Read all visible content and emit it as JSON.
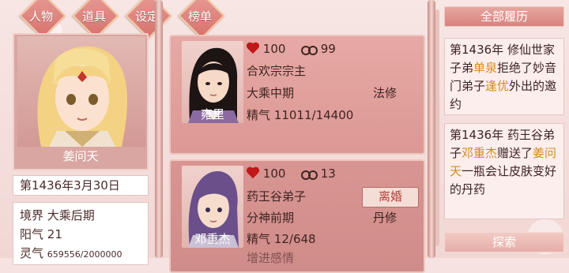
{
  "tabs": [
    {
      "label": "人物"
    },
    {
      "label": "道具"
    },
    {
      "label": "设定"
    },
    {
      "label": "榜单"
    }
  ],
  "player": {
    "name": "姜问天",
    "date": "第1436年3月30日",
    "realm_label": "境界",
    "realm_value": "大乘后期",
    "yang_label": "阳气",
    "yang_value": "21",
    "spirit_label": "灵气",
    "spirit_value": "659556/2000000"
  },
  "partners": [
    {
      "name": "雍里",
      "affection": "100",
      "bond": "99",
      "title": "合欢宗宗主",
      "realm": "大乘中期",
      "class": "法修",
      "essence_label": "精气",
      "essence": "11011/14400"
    },
    {
      "name": "邓重杰",
      "affection": "100",
      "bond": "13",
      "title": "药王谷弟子",
      "realm": "分神前期",
      "class": "丹修",
      "essence_label": "精气",
      "essence": "12/648",
      "divorce_label": "离婚",
      "extra_line": "增进感情"
    }
  ],
  "history": {
    "header": "全部履历",
    "entries": [
      {
        "seg1": "第1436年 修仙世家子弟",
        "hl1": "单泉",
        "seg2": "拒绝了妙音门弟子",
        "hl2": "逢优",
        "seg3": "外出的邀约"
      },
      {
        "seg1": "第1436年 药王谷弟子",
        "hl1": "邓重杰",
        "seg2": "赠送了",
        "hl2": "姜问天",
        "seg3": "一瓶会让皮肤变好的丹药"
      }
    ],
    "explore_label": "探索"
  },
  "colors": {
    "highlight": "#d58a1e",
    "heart": "#c01818",
    "panel_pink": "#d9a6a2"
  }
}
